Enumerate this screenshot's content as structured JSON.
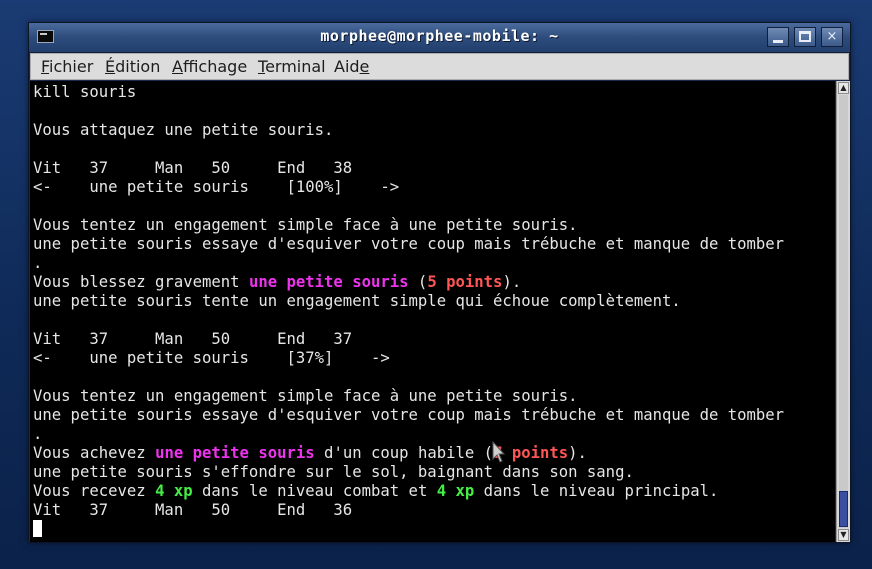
{
  "window": {
    "title": "morphee@morphee-mobile: ~",
    "controls": {
      "minimize": "minimize",
      "maximize": "maximize",
      "close": "×"
    }
  },
  "menubar": {
    "items": [
      {
        "pre": "",
        "acc": "F",
        "post": "ichier"
      },
      {
        "pre": "",
        "acc": "É",
        "post": "dition"
      },
      {
        "pre": "",
        "acc": "A",
        "post": "ffichage"
      },
      {
        "pre": "",
        "acc": "T",
        "post": "erminal"
      },
      {
        "pre": "Aid",
        "acc": "e",
        "post": ""
      }
    ]
  },
  "terminal": {
    "lines": [
      [
        {
          "t": "kill souris"
        }
      ],
      [],
      [
        {
          "t": "Vous attaquez une petite souris."
        }
      ],
      [],
      [
        {
          "t": "Vit   37     Man   50     End   38"
        }
      ],
      [
        {
          "t": "<-    une petite souris    [100%]    ->"
        }
      ],
      [],
      [
        {
          "t": "Vous tentez un engagement simple face à une petite souris."
        }
      ],
      [
        {
          "t": "une petite souris essaye d'esquiver votre coup mais trébuche et manque de tomber"
        }
      ],
      [
        {
          "t": "."
        }
      ],
      [
        {
          "t": "Vous blessez gravement "
        },
        {
          "t": "une petite souris",
          "c": "mob"
        },
        {
          "t": " ("
        },
        {
          "t": "5 points",
          "c": "dmg"
        },
        {
          "t": ")."
        }
      ],
      [
        {
          "t": "une petite souris tente un engagement simple qui échoue complètement."
        }
      ],
      [],
      [
        {
          "t": "Vit   37     Man   50     End   37"
        }
      ],
      [
        {
          "t": "<-    une petite souris    [37%]    ->"
        }
      ],
      [],
      [
        {
          "t": "Vous tentez un engagement simple face à une petite souris."
        }
      ],
      [
        {
          "t": "une petite souris essaye d'esquiver votre coup mais trébuche et manque de tomber"
        }
      ],
      [
        {
          "t": "."
        }
      ],
      [
        {
          "t": "Vous achevez "
        },
        {
          "t": "une petite souris",
          "c": "mob"
        },
        {
          "t": " d'un coup habile ("
        },
        {
          "t": "7 points",
          "c": "dmg"
        },
        {
          "t": ")."
        }
      ],
      [
        {
          "t": "une petite souris s'effondre sur le sol, baignant dans son sang."
        }
      ],
      [
        {
          "t": "Vous recevez "
        },
        {
          "t": "4 xp",
          "c": "xp"
        },
        {
          "t": " dans le niveau combat et "
        },
        {
          "t": "4 xp",
          "c": "xp"
        },
        {
          "t": " dans le niveau principal."
        }
      ],
      [
        {
          "t": "Vit   37     Man   50     End   36"
        }
      ],
      []
    ],
    "colors": {
      "mob": "#ee33ee",
      "damage": "#ff5555",
      "xp": "#44ee44",
      "text": "#e6e6e6",
      "background": "#000000"
    },
    "cursor_visible": true
  },
  "scrollbar": {
    "position_fraction": 1.0
  }
}
